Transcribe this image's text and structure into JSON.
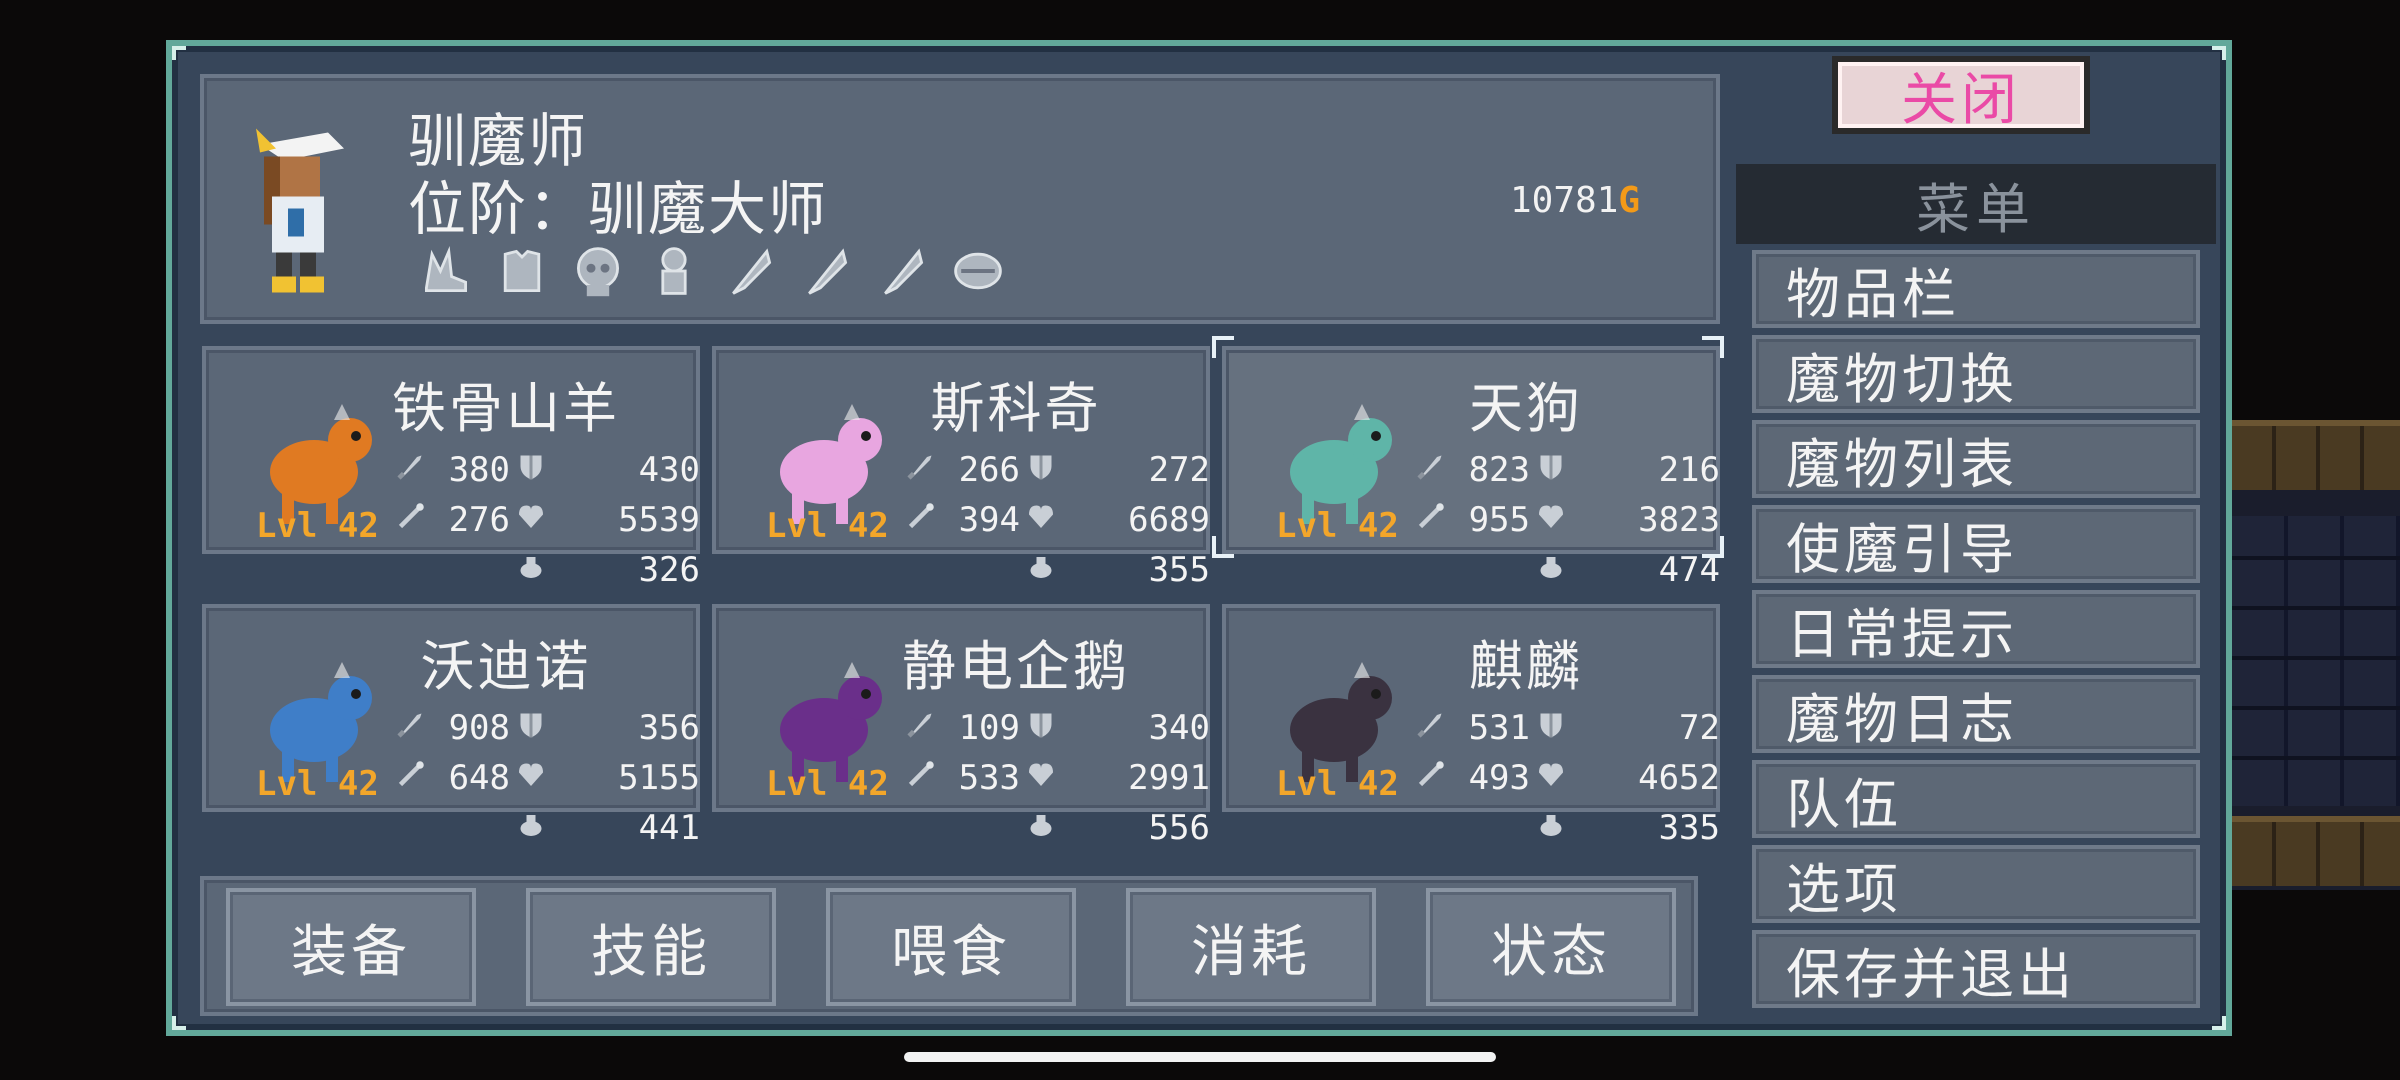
{
  "trainer": {
    "name": "驯魔师",
    "rank": "位阶：驯魔大师",
    "gold": "10781",
    "gold_icon": "G",
    "key_items": [
      "wing-boots-icon",
      "armor-icon",
      "skull-relic-icon",
      "idol-icon",
      "feather-icon",
      "feather-icon",
      "feather-icon",
      "stone-tablet-icon"
    ]
  },
  "monsters": [
    {
      "name": "铁骨山羊",
      "level": "Lvl 42",
      "atk": "380",
      "def": "430",
      "mag": "276",
      "hp": "5539",
      "mp": "326",
      "sprite": "ram-monster",
      "color": "#e07a22"
    },
    {
      "name": "斯科奇",
      "level": "Lvl 42",
      "atk": "266",
      "def": "272",
      "mag": "394",
      "hp": "6689",
      "mp": "355",
      "sprite": "fox-cat-monster",
      "color": "#e8a6e0"
    },
    {
      "name": "天狗",
      "level": "Lvl 42",
      "atk": "823",
      "def": "216",
      "mag": "955",
      "hp": "3823",
      "mp": "474",
      "sprite": "tengu-monster",
      "color": "#5fb5a8"
    },
    {
      "name": "沃迪诺",
      "level": "Lvl 42",
      "atk": "908",
      "def": "356",
      "mag": "648",
      "hp": "5155",
      "mp": "441",
      "sprite": "fish-warrior-monster",
      "color": "#3f7ec8"
    },
    {
      "name": "静电企鹅",
      "level": "Lvl 42",
      "atk": "109",
      "def": "340",
      "mag": "533",
      "hp": "2991",
      "mp": "556",
      "sprite": "penguin-monster",
      "color": "#6a2f8a"
    },
    {
      "name": "麒麟",
      "level": "Lvl 42",
      "atk": "531",
      "def": "72",
      "mag": "493",
      "hp": "4652",
      "mp": "335",
      "sprite": "qilin-monster",
      "color": "#3a3240"
    }
  ],
  "tabs": [
    "装备",
    "技能",
    "喂食",
    "消耗",
    "状态"
  ],
  "close_label": "关闭",
  "menu": {
    "header": "菜单",
    "items": [
      "物品栏",
      "魔物切换",
      "魔物列表",
      "使魔引导",
      "日常提示",
      "魔物日志",
      "队伍",
      "选项",
      "保存并退出"
    ]
  },
  "colors": {
    "frame_border": "#62a89a",
    "level_text": "#f3a62a",
    "close_text": "#ea4aa6",
    "gold_icon": "#f39a18"
  }
}
